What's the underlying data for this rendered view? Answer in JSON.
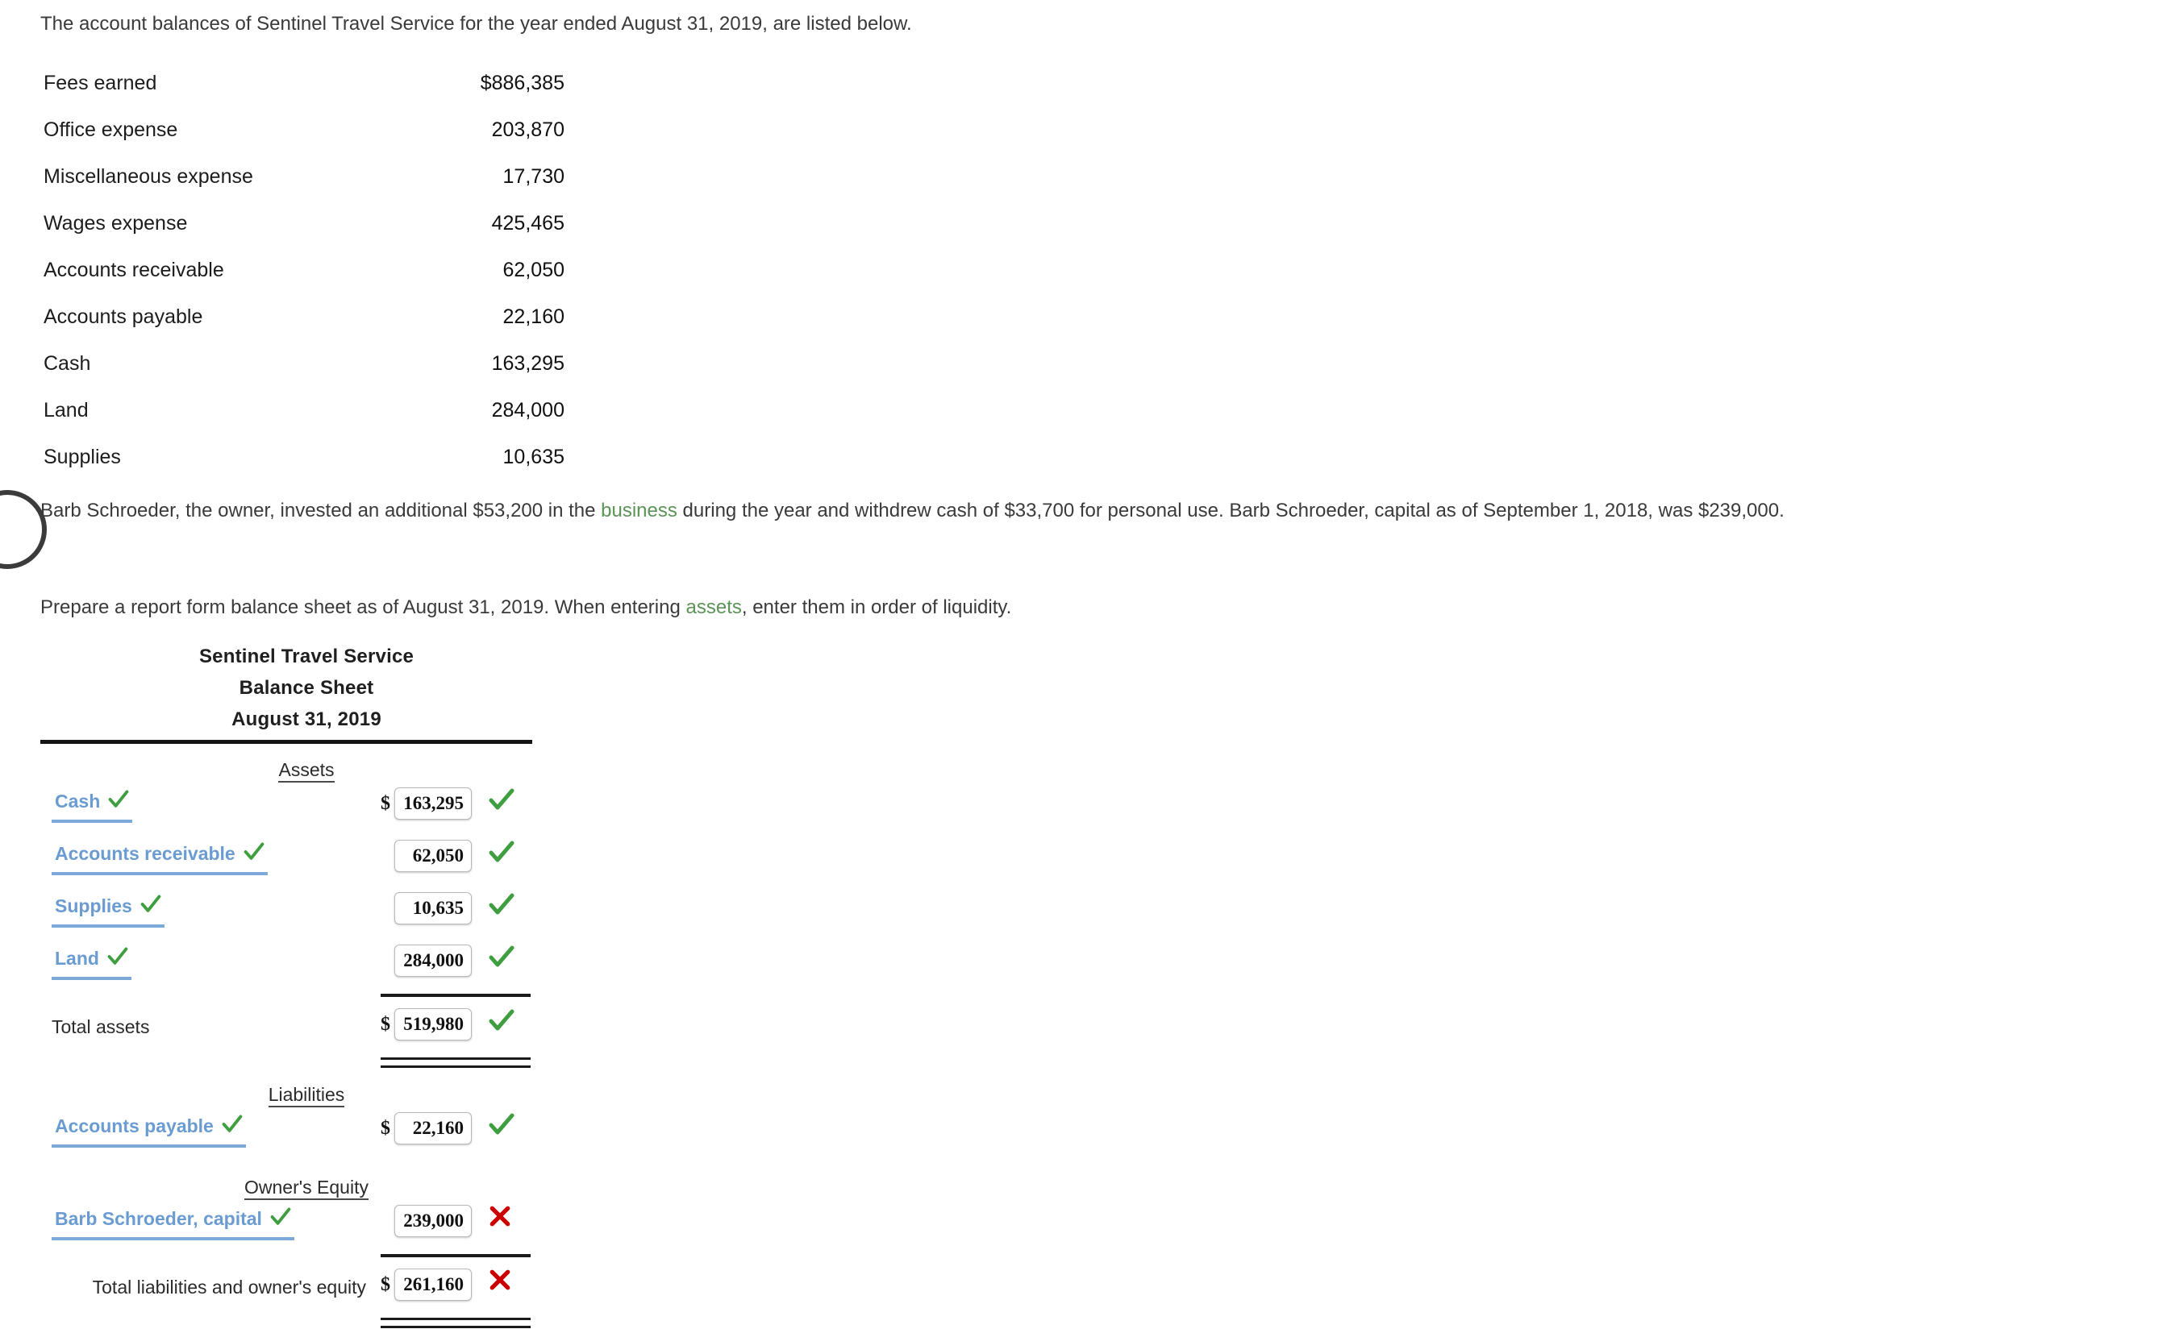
{
  "intro": {
    "text": "The account balances of Sentinel Travel Service for the year ended August 31, 2019, are listed below."
  },
  "account_balances": {
    "rows": [
      {
        "name": "Fees earned",
        "value": "$886,385"
      },
      {
        "name": "Office expense",
        "value": "203,870"
      },
      {
        "name": "Miscellaneous expense",
        "value": "17,730"
      },
      {
        "name": "Wages expense",
        "value": "425,465"
      },
      {
        "name": "Accounts receivable",
        "value": "62,050"
      },
      {
        "name": "Accounts payable",
        "value": "22,160"
      },
      {
        "name": "Cash",
        "value": "163,295"
      },
      {
        "name": "Land",
        "value": "284,000"
      },
      {
        "name": "Supplies",
        "value": "10,635"
      }
    ]
  },
  "owner_paragraph": {
    "part1": "Barb Schroeder, the owner, invested an additional $53,200 in the ",
    "link": "business",
    "part2": " during the year and withdrew cash of $33,700 for personal use. Barb Schroeder, capital as of September 1, 2018, was $239,000."
  },
  "instruction_paragraph": {
    "part1": "Prepare a report form balance sheet as of August 31, 2019. When entering ",
    "link": "assets",
    "part2": ", enter them in order of liquidity."
  },
  "balance_sheet": {
    "company": "Sentinel Travel Service",
    "statement": "Balance Sheet",
    "date": "August 31, 2019",
    "sections": {
      "assets": "Assets",
      "liabilities": "Liabilities",
      "owners_equity": "Owner's Equity"
    },
    "asset_rows": [
      {
        "label": "Cash",
        "value": "163,295",
        "dollar": "$",
        "status": "correct"
      },
      {
        "label": "Accounts receivable",
        "value": "62,050",
        "dollar": "",
        "status": "correct"
      },
      {
        "label": "Supplies",
        "value": "10,635",
        "dollar": "",
        "status": "correct"
      },
      {
        "label": "Land",
        "value": "284,000",
        "dollar": "",
        "status": "correct"
      }
    ],
    "total_assets": {
      "label": "Total assets",
      "value": "519,980",
      "dollar": "$",
      "status": "correct"
    },
    "liability_rows": [
      {
        "label": "Accounts payable",
        "value": "22,160",
        "dollar": "$",
        "status": "correct"
      }
    ],
    "equity_rows": [
      {
        "label": "Barb Schroeder, capital",
        "value": "239,000",
        "dollar": "",
        "status": "incorrect"
      }
    ],
    "total_liab_equity": {
      "label": "Total liabilities and owner's equity",
      "value": "261,160",
      "dollar": "$",
      "status": "incorrect"
    },
    "icons": {
      "correct": "green-check-icon",
      "incorrect": "red-x-icon"
    },
    "colors": {
      "select_label": "#6a9bd1",
      "correct": "#3f9e3f",
      "incorrect": "#cc0000",
      "link": "#5b9456"
    }
  }
}
